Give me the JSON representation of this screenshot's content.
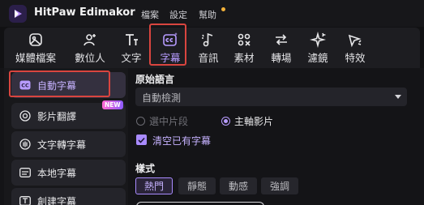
{
  "app": {
    "title": "HitPaw Edimakor",
    "menus": [
      "檔案",
      "設定",
      "幫助"
    ]
  },
  "toolbar": {
    "tools": [
      {
        "label": "媒體檔案",
        "icon": "media-icon"
      },
      {
        "label": "數位人",
        "icon": "avatar-add-icon"
      },
      {
        "label": "文字",
        "icon": "text-icon"
      },
      {
        "label": "字幕",
        "icon": "subtitle-ai-icon"
      },
      {
        "label": "音訊",
        "icon": "music-note-icon"
      },
      {
        "label": "素材",
        "icon": "assets-icon"
      },
      {
        "label": "轉場",
        "icon": "transition-icon"
      },
      {
        "label": "濾鏡",
        "icon": "sparkle-filter-icon"
      },
      {
        "label": "特效",
        "icon": "effects-icon"
      }
    ],
    "active": "字幕"
  },
  "sidebar": {
    "items": [
      {
        "label": "自動字幕",
        "icon": "cc-icon"
      },
      {
        "label": "影片翻譯",
        "icon": "translate-icon",
        "badge": "NEW"
      },
      {
        "label": "文字轉字幕",
        "icon": "text-to-subtitle-icon"
      },
      {
        "label": "本地字幕",
        "icon": "local-subtitle-icon"
      },
      {
        "label": "創建字幕",
        "icon": "create-subtitle-icon"
      }
    ],
    "active": "自動字幕"
  },
  "panel": {
    "language_title": "原始語言",
    "language_value": "自動檢測",
    "radio_options": [
      {
        "label": "選中片段",
        "selected": false
      },
      {
        "label": "主軸影片",
        "selected": true
      }
    ],
    "checkbox_label": "清空已有字幕",
    "checkbox_checked": true,
    "style_title": "樣式",
    "style_chips": [
      "熱門",
      "靜態",
      "動感",
      "強調"
    ],
    "style_active": "熱門"
  },
  "colors": {
    "accent": "#b79cff",
    "highlight_border": "#d9453f",
    "new_badge": "#ff69d1"
  }
}
